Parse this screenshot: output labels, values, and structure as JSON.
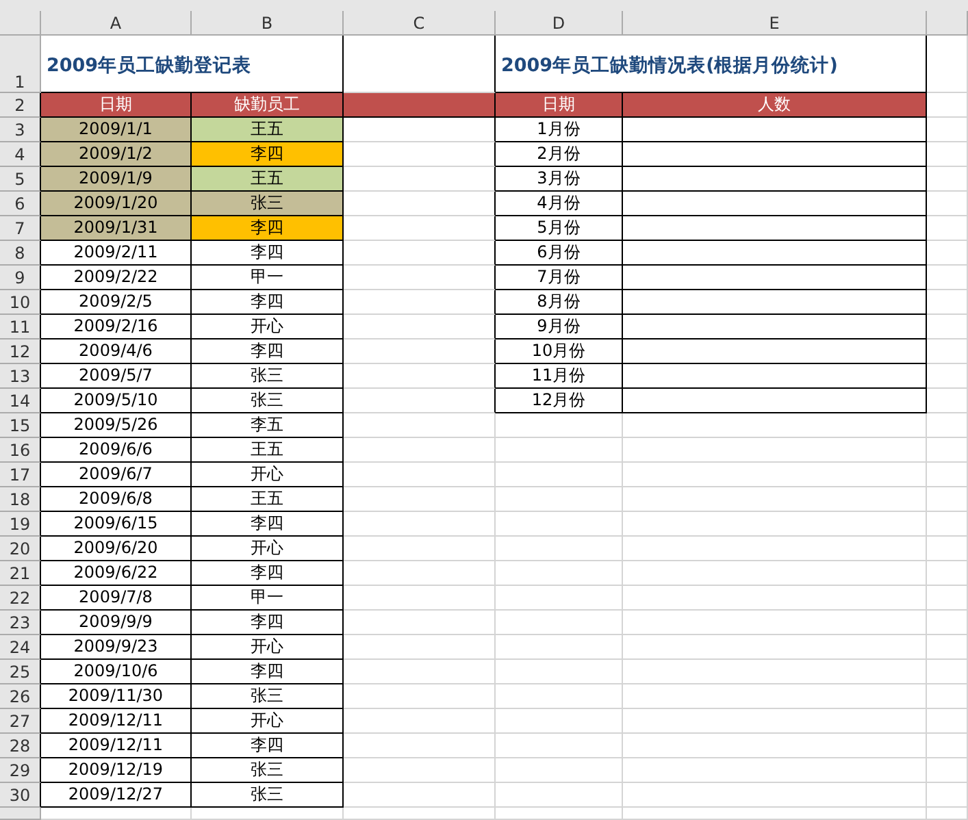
{
  "sheet": {
    "columns": [
      "A",
      "B",
      "C",
      "D",
      "E"
    ],
    "row_numbers": [
      "1",
      "2",
      "3",
      "4",
      "5",
      "6",
      "7",
      "8",
      "9",
      "10",
      "11",
      "12",
      "13",
      "14",
      "15",
      "16",
      "17",
      "18",
      "19",
      "20",
      "21",
      "22",
      "23",
      "24",
      "25",
      "26",
      "27",
      "28",
      "29",
      "30"
    ],
    "register": {
      "title": "2009年员工缺勤登记表",
      "headers": [
        "日期",
        "缺勤员工"
      ],
      "rows": [
        {
          "date": {
            "text": "2009/1/1",
            "color": "#c4bd97"
          },
          "employee": {
            "text": "王五",
            "color": "#c4d79b"
          }
        },
        {
          "date": {
            "text": "2009/1/2",
            "color": "#c4bd97"
          },
          "employee": {
            "text": "李四",
            "color": "#ffc000"
          }
        },
        {
          "date": {
            "text": "2009/1/9",
            "color": "#c4bd97"
          },
          "employee": {
            "text": "王五",
            "color": "#c4d79b"
          }
        },
        {
          "date": {
            "text": "2009/1/20",
            "color": "#c4bd97"
          },
          "employee": {
            "text": "张三",
            "color": "#c4bd97"
          }
        },
        {
          "date": {
            "text": "2009/1/31",
            "color": "#c4bd97"
          },
          "employee": {
            "text": "李四",
            "color": "#ffc000"
          }
        },
        {
          "date": {
            "text": "2009/2/11"
          },
          "employee": {
            "text": "李四"
          }
        },
        {
          "date": {
            "text": "2009/2/22"
          },
          "employee": {
            "text": "甲一"
          }
        },
        {
          "date": {
            "text": "2009/2/5"
          },
          "employee": {
            "text": "李四"
          }
        },
        {
          "date": {
            "text": "2009/2/16"
          },
          "employee": {
            "text": "开心"
          }
        },
        {
          "date": {
            "text": "2009/4/6"
          },
          "employee": {
            "text": "李四"
          }
        },
        {
          "date": {
            "text": "2009/5/7"
          },
          "employee": {
            "text": "张三"
          }
        },
        {
          "date": {
            "text": "2009/5/10"
          },
          "employee": {
            "text": "张三"
          }
        },
        {
          "date": {
            "text": "2009/5/26"
          },
          "employee": {
            "text": "李五"
          }
        },
        {
          "date": {
            "text": "2009/6/6"
          },
          "employee": {
            "text": "王五"
          }
        },
        {
          "date": {
            "text": "2009/6/7"
          },
          "employee": {
            "text": "开心"
          }
        },
        {
          "date": {
            "text": "2009/6/8"
          },
          "employee": {
            "text": "王五"
          }
        },
        {
          "date": {
            "text": "2009/6/15"
          },
          "employee": {
            "text": "李四"
          }
        },
        {
          "date": {
            "text": "2009/6/20"
          },
          "employee": {
            "text": "开心"
          }
        },
        {
          "date": {
            "text": "2009/6/22"
          },
          "employee": {
            "text": "李四"
          }
        },
        {
          "date": {
            "text": "2009/7/8"
          },
          "employee": {
            "text": "甲一"
          }
        },
        {
          "date": {
            "text": "2009/9/9"
          },
          "employee": {
            "text": "李四"
          }
        },
        {
          "date": {
            "text": "2009/9/23"
          },
          "employee": {
            "text": "开心"
          }
        },
        {
          "date": {
            "text": "2009/10/6"
          },
          "employee": {
            "text": "李四"
          }
        },
        {
          "date": {
            "text": "2009/11/30"
          },
          "employee": {
            "text": "张三"
          }
        },
        {
          "date": {
            "text": "2009/12/11"
          },
          "employee": {
            "text": "开心"
          }
        },
        {
          "date": {
            "text": "2009/12/11"
          },
          "employee": {
            "text": "李四"
          }
        },
        {
          "date": {
            "text": "2009/12/19"
          },
          "employee": {
            "text": "张三"
          }
        },
        {
          "date": {
            "text": "2009/12/27"
          },
          "employee": {
            "text": "张三"
          }
        }
      ]
    },
    "summary": {
      "title": "2009年员工缺勤情况表(根据月份统计)",
      "headers": [
        "日期",
        "人数"
      ],
      "rows": [
        {
          "month": "1月份"
        },
        {
          "month": "2月份"
        },
        {
          "month": "3月份"
        },
        {
          "month": "4月份"
        },
        {
          "month": "5月份"
        },
        {
          "month": "6月份"
        },
        {
          "month": "7月份"
        },
        {
          "month": "8月份"
        },
        {
          "month": "9月份"
        },
        {
          "month": "10月份"
        },
        {
          "month": "11月份"
        },
        {
          "month": "12月份"
        }
      ]
    }
  }
}
